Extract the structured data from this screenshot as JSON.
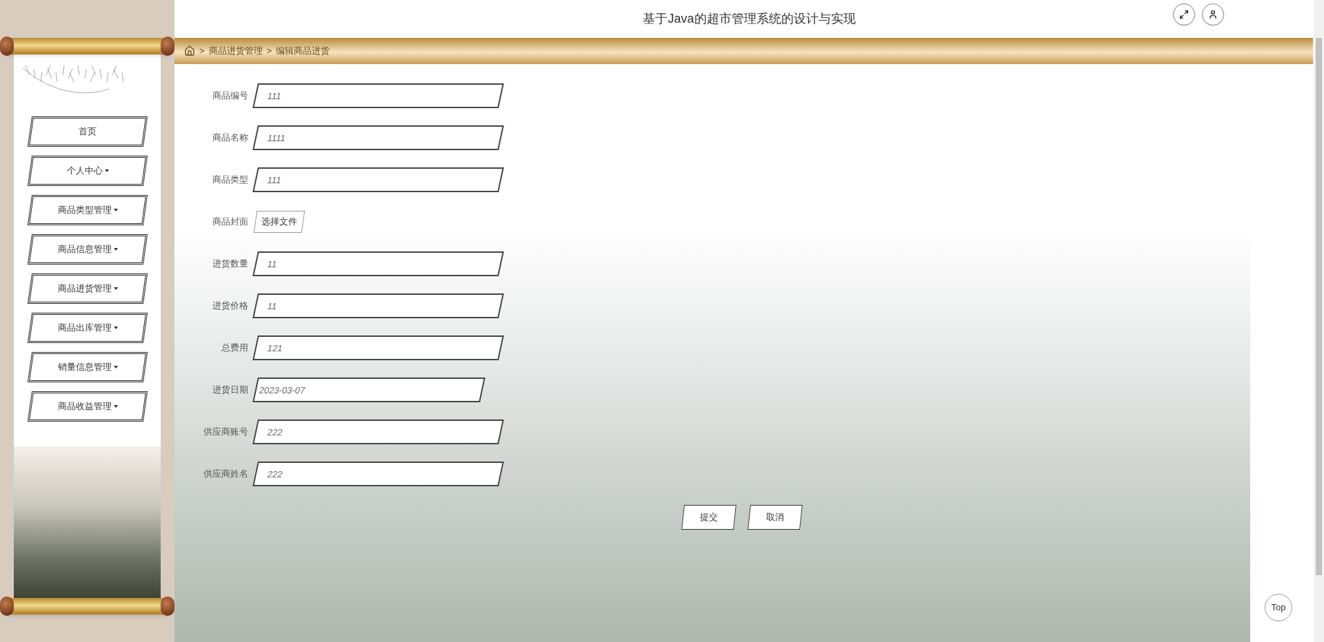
{
  "header": {
    "title": "基于Java的超市管理系统的设计与实现"
  },
  "breadcrumb": [
    {
      "separator": ">",
      "label": "商品进货管理"
    },
    {
      "separator": ">",
      "label": "编辑商品进货"
    }
  ],
  "sidebar": {
    "items": [
      {
        "label": "首页",
        "dropdown": false
      },
      {
        "label": "个人中心",
        "dropdown": true
      },
      {
        "label": "商品类型管理",
        "dropdown": true
      },
      {
        "label": "商品信息管理",
        "dropdown": true
      },
      {
        "label": "商品进货管理",
        "dropdown": true
      },
      {
        "label": "商品出库管理",
        "dropdown": true
      },
      {
        "label": "销量信息管理",
        "dropdown": true
      },
      {
        "label": "商品收益管理",
        "dropdown": true
      }
    ]
  },
  "form": {
    "fields": [
      {
        "kind": "text",
        "label": "商品编号",
        "value": "111"
      },
      {
        "kind": "text",
        "label": "商品名称",
        "value": "1111"
      },
      {
        "kind": "text",
        "label": "商品类型",
        "value": "111"
      },
      {
        "kind": "file",
        "label": "商品封面",
        "button": "选择文件"
      },
      {
        "kind": "text",
        "label": "进货数量",
        "value": "11"
      },
      {
        "kind": "text",
        "label": "进货价格",
        "value": "11"
      },
      {
        "kind": "text",
        "label": "总费用",
        "value": "121"
      },
      {
        "kind": "date",
        "label": "进货日期",
        "value": "2023-03-07"
      },
      {
        "kind": "text",
        "label": "供应商账号",
        "value": "222"
      },
      {
        "kind": "text",
        "label": "供应商姓名",
        "value": "222"
      }
    ],
    "buttons": [
      "提交",
      "取消"
    ]
  },
  "back_to_top": "Top"
}
